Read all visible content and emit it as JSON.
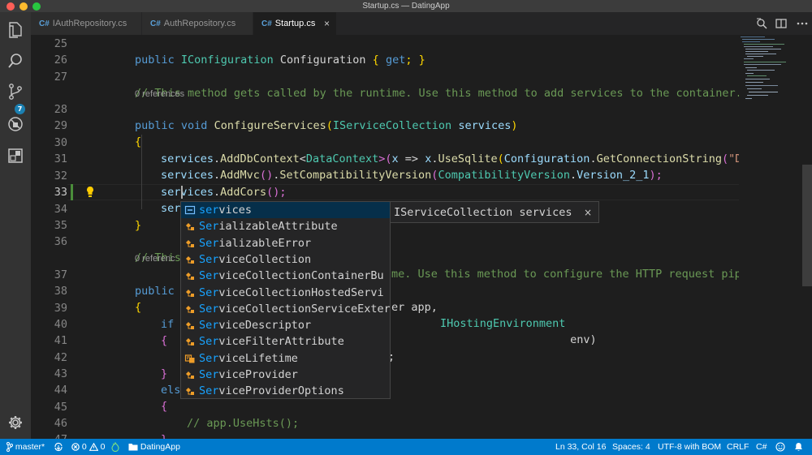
{
  "window": {
    "title": "Startup.cs — DatingApp"
  },
  "tabs": [
    {
      "icon": "C#",
      "label": "IAuthRepository.cs"
    },
    {
      "icon": "C#",
      "label": "AuthRepository.cs"
    },
    {
      "icon": "C#",
      "label": "Startup.cs",
      "close": "×"
    }
  ],
  "activity": {
    "scm_badge": "7"
  },
  "editor": {
    "line_numbers": [
      "25",
      "26",
      "27",
      "28",
      "29",
      "30",
      "31",
      "32",
      "33",
      "34",
      "35",
      "36",
      "37",
      "38",
      "39",
      "40",
      "41",
      "42",
      "43",
      "44",
      "45",
      "46",
      "47"
    ],
    "active_line": "33",
    "lens_28": "0 references",
    "lens_36": "0 references",
    "line25": {
      "a": "public",
      "b": "IConfiguration",
      "c": "Configuration",
      "d": "{",
      "e": "get",
      "f": "; }"
    },
    "line27": {
      "comment": "// This method gets called by the runtime. Use this method to add services to the container."
    },
    "line28": {
      "a": "public",
      "b": "void",
      "c": "ConfigureServices",
      "d": "(",
      "e": "IServiceCollection",
      "f": "services",
      "g": ")"
    },
    "line29": {
      "a": "{"
    },
    "line30": {
      "a": "services",
      "b": ".",
      "c": "AddDbContext",
      "d": "<",
      "e": "DataContext",
      "f": ">(",
      "g": "x",
      "h": " => ",
      "i": "x",
      "j": ".",
      "k": "UseSqlite",
      "l": "(",
      "m": "Configuration",
      "n": ".",
      "o": "GetConnectionString",
      "p": "(",
      "q": "\"De"
    },
    "line31": {
      "a": "services",
      "b": ".",
      "c": "AddMvc",
      "d": "()",
      "e": ".",
      "f": "SetCompatibilityVersion",
      "g": "(",
      "h": "CompatibilityVersion",
      "i": ".",
      "j": "Version_2_1",
      "k": ");"
    },
    "line32": {
      "a": "services",
      "b": ".",
      "c": "AddCors",
      "d": "();"
    },
    "line33": {
      "a": "ser"
    },
    "line34": {
      "a": "}"
    },
    "line36": {
      "a": "// This",
      "b": "me. Use this method to configure the HTTP request pipe"
    },
    "line36_lens_prefix": "0 referenc",
    "line37": {
      "a": "public",
      "b": "er app, ",
      "c": "IHostingEnvironment",
      "d": " env)"
    },
    "line38": {
      "a": "{"
    },
    "line39": {
      "a": "if"
    },
    "line40": {
      "a": "{"
    },
    "line41": {
      "a": ";"
    },
    "line42": {
      "a": "}"
    },
    "line43": {
      "a": "els"
    },
    "line44": {
      "a": "{"
    },
    "line45": {
      "a": "// app.UseHsts();"
    },
    "line46": {
      "a": "}"
    }
  },
  "suggest": {
    "items": [
      {
        "match": "ser",
        "rest": "vices",
        "kind": "field-icon"
      },
      {
        "match": "Ser",
        "rest": "ializableAttribute",
        "kind": "class-icon"
      },
      {
        "match": "Ser",
        "rest": "ializableError",
        "kind": "class-icon"
      },
      {
        "match": "Ser",
        "rest": "viceCollection",
        "kind": "class-icon"
      },
      {
        "match": "Ser",
        "rest": "viceCollectionContainerBu",
        "kind": "class-icon"
      },
      {
        "match": "Ser",
        "rest": "viceCollectionHostedServi",
        "kind": "class-icon"
      },
      {
        "match": "Ser",
        "rest": "viceCollectionServiceExter",
        "kind": "class-icon"
      },
      {
        "match": "Ser",
        "rest": "viceDescriptor",
        "kind": "class-icon"
      },
      {
        "match": "Ser",
        "rest": "viceFilterAttribute",
        "kind": "class-icon"
      },
      {
        "match": "Ser",
        "rest": "viceLifetime",
        "kind": "enum-icon"
      },
      {
        "match": "Ser",
        "rest": "viceProvider",
        "kind": "class-icon"
      },
      {
        "match": "Ser",
        "rest": "viceProviderOptions",
        "kind": "class-icon"
      }
    ],
    "details": "IServiceCollection services",
    "details_close": "×"
  },
  "statusbar": {
    "branch": "master*",
    "errors": "0",
    "warnings": "0",
    "project": "DatingApp",
    "position": "Ln 33, Col 16",
    "spaces": "Spaces: 4",
    "encoding": "UTF-8 with BOM",
    "eol": "CRLF",
    "language": "C#"
  },
  "colors": {
    "accent": "#007acc",
    "editor_bg": "#1e1e1e",
    "suggest_match": "#18a3ff"
  }
}
